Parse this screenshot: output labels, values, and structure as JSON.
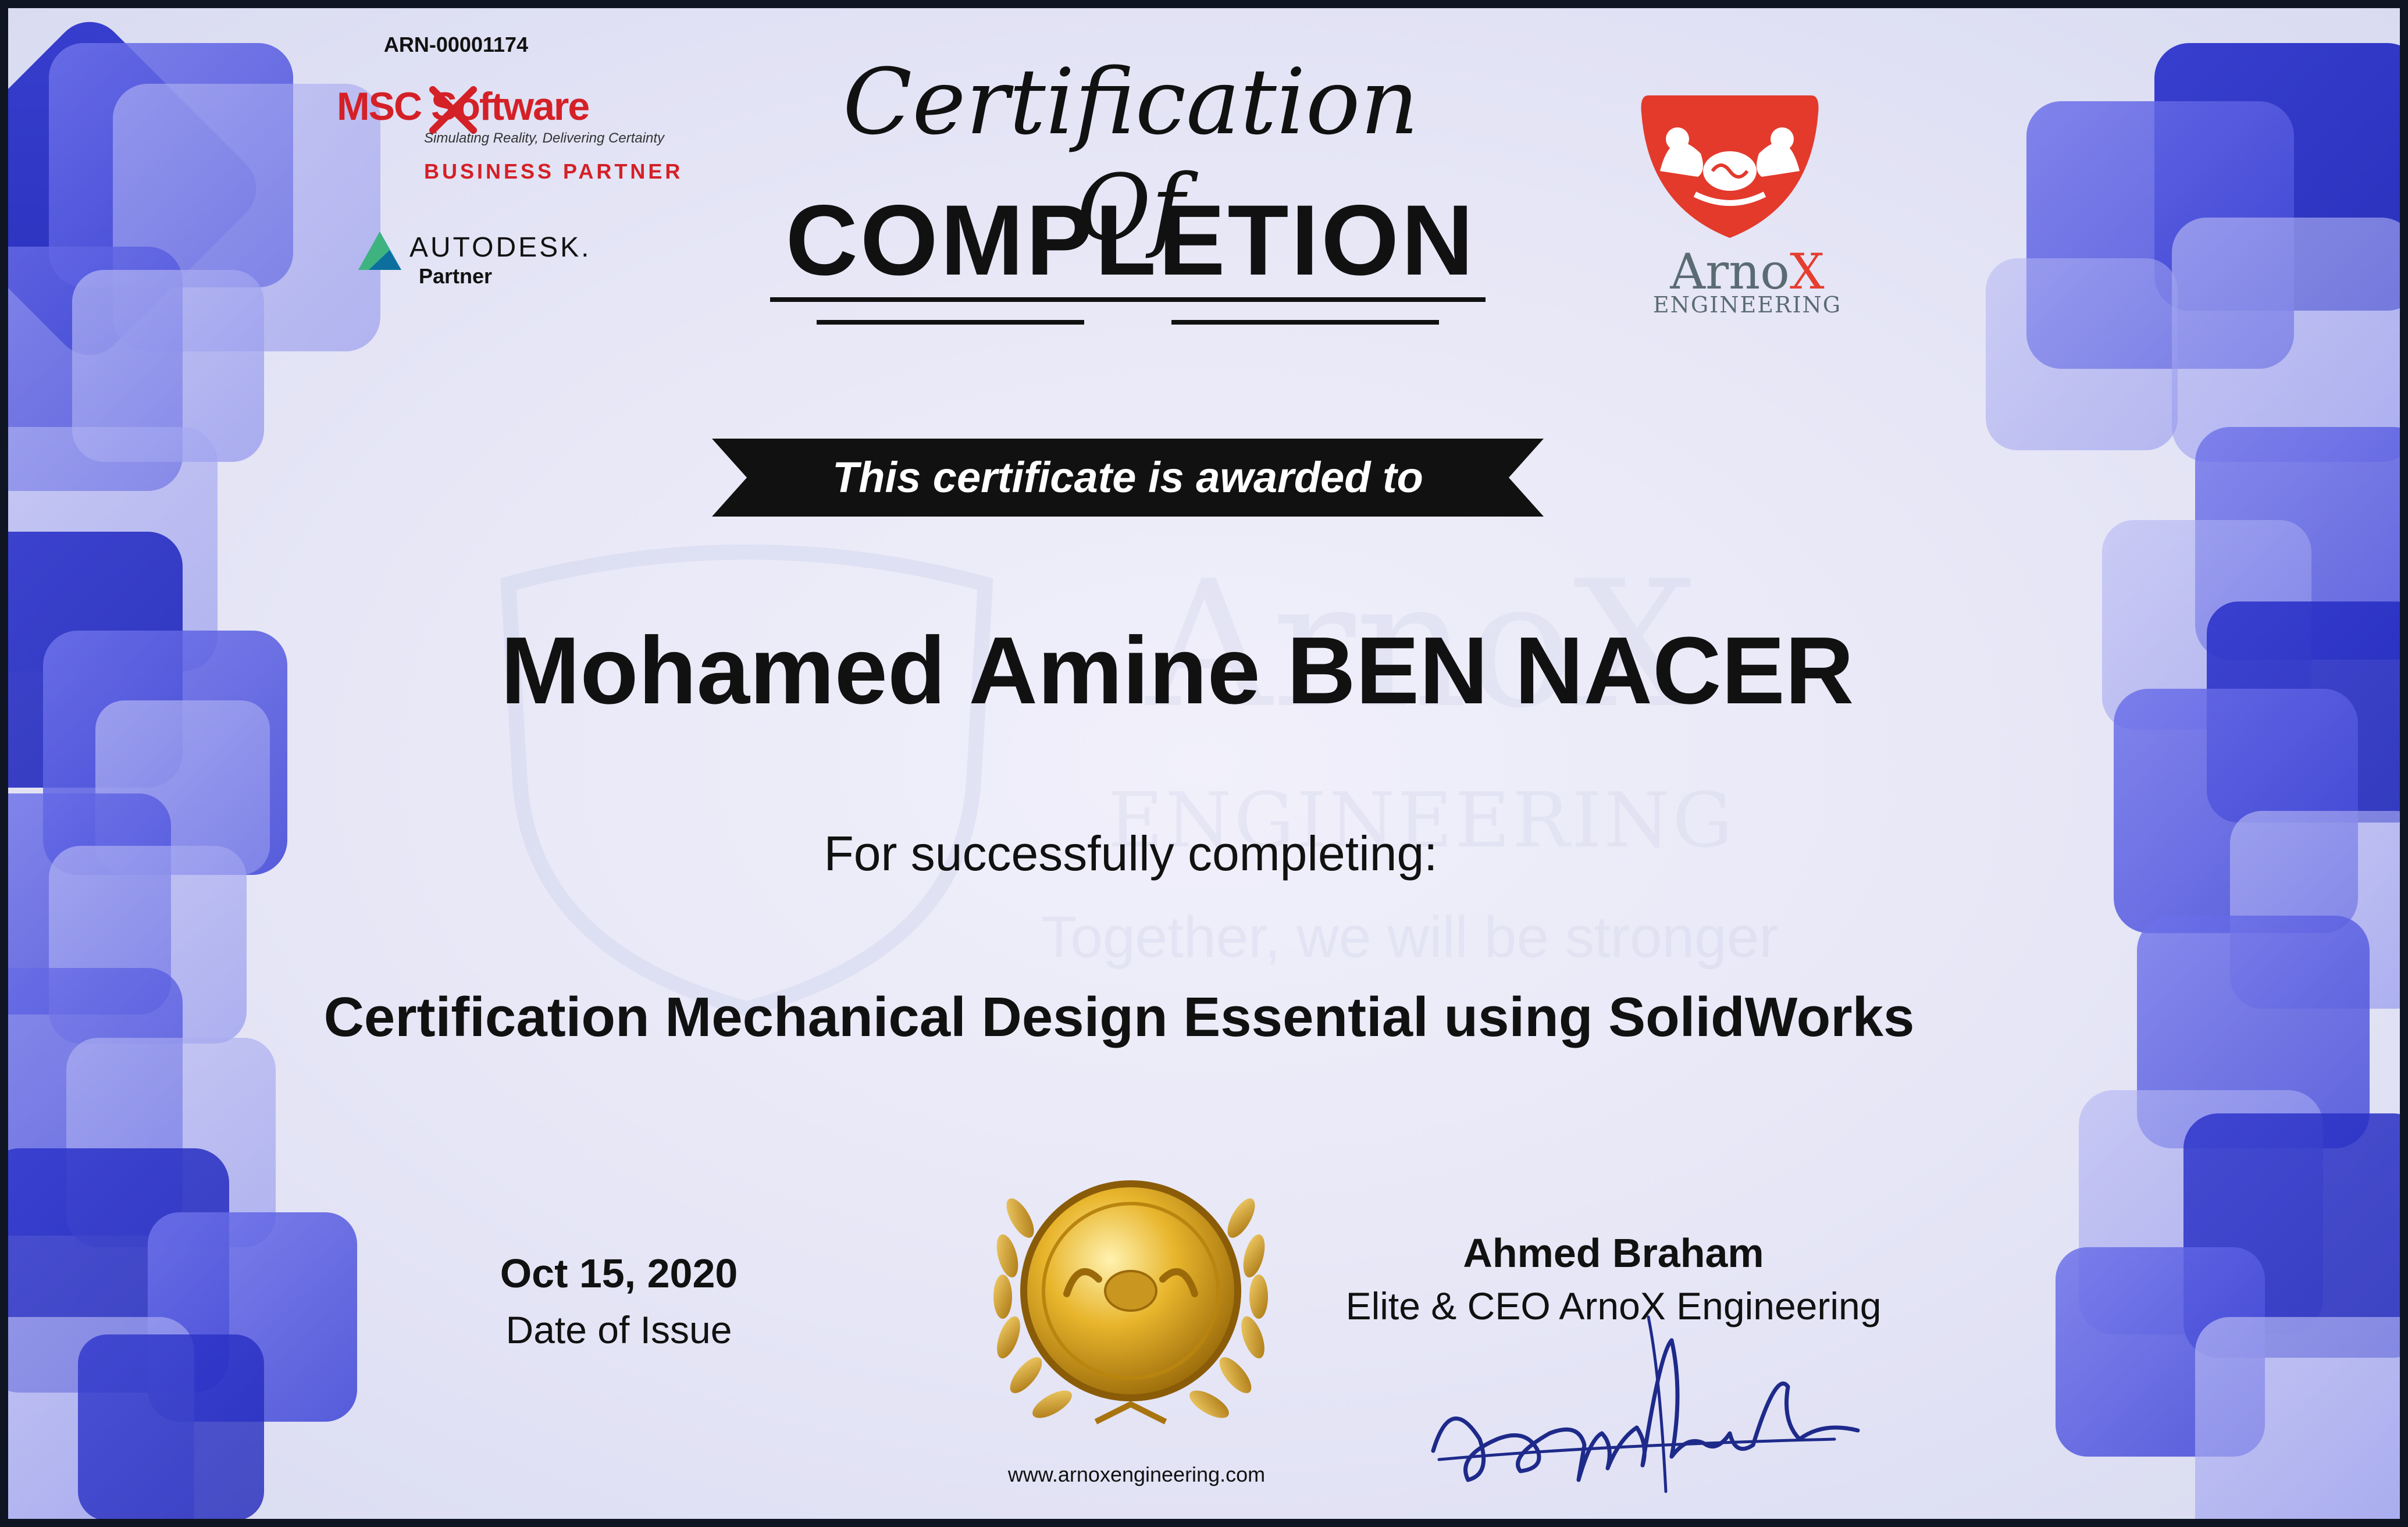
{
  "certificate_id": "ARN-00001174",
  "partners": {
    "msc": {
      "brand": "MSC Software",
      "tagline": "Simulating Reality, Delivering Certainty",
      "program": "BUSINESS PARTNER"
    },
    "autodesk": {
      "brand": "AUTODESK.",
      "program": "Partner"
    }
  },
  "heading": {
    "script": "Certification Of",
    "main": "COMPLETION"
  },
  "awarded_to": "This certificate is awarded to",
  "recipient": "Mohamed Amine BEN NACER",
  "completion_text": "For successfully completing:",
  "course": "Certification Mechanical Design Essential using SolidWorks",
  "issue": {
    "date": "Oct 15, 2020",
    "label": "Date of Issue"
  },
  "signatory": {
    "name": "Ahmed Braham",
    "title": "Elite & CEO ArnoX Engineering"
  },
  "website": "www.arnoxengineering.com",
  "company": {
    "name_part1": "Arno",
    "name_part2": "X",
    "subtitle": "ENGINEERING"
  },
  "watermark": {
    "name": "ArnoX",
    "subtitle": "ENGINEERING",
    "tagline": "Together, we will be stronger"
  },
  "colors": {
    "accent_blue": "#3e44d6",
    "brand_red": "#e53d2f",
    "gold": "#d9a21c",
    "text": "#111111"
  },
  "icons": {
    "msc_logo": "msc-x-logo",
    "autodesk_logo": "autodesk-triangle-logo",
    "arnox_logo": "flexing-brain-shield-logo",
    "seal": "gold-laurel-seal"
  }
}
